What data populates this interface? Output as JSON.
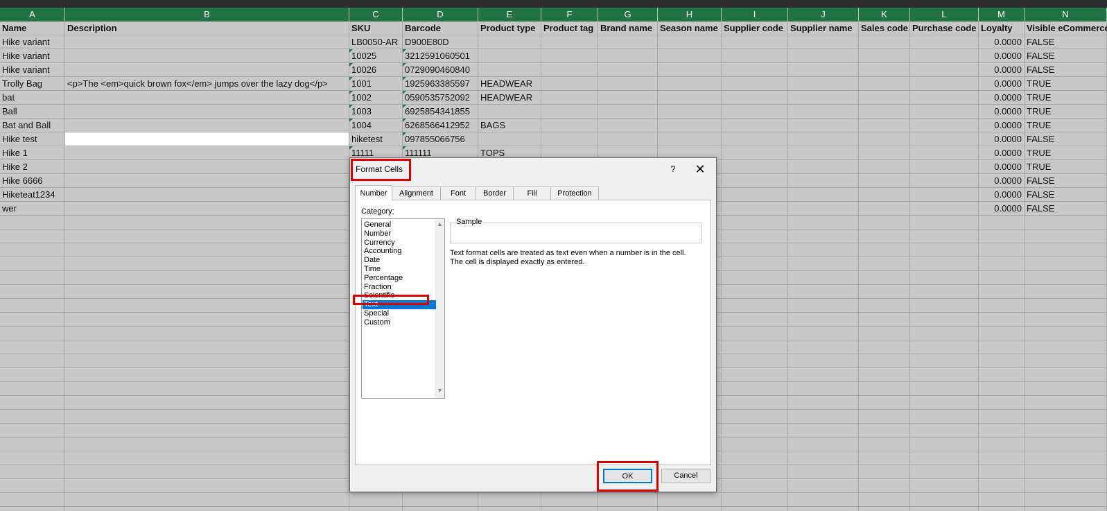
{
  "columns": [
    {
      "letter": "A",
      "header": "Name"
    },
    {
      "letter": "B",
      "header": "Description"
    },
    {
      "letter": "C",
      "header": "SKU"
    },
    {
      "letter": "D",
      "header": "Barcode"
    },
    {
      "letter": "E",
      "header": "Product type"
    },
    {
      "letter": "F",
      "header": "Product tag"
    },
    {
      "letter": "G",
      "header": "Brand name"
    },
    {
      "letter": "H",
      "header": "Season name"
    },
    {
      "letter": "I",
      "header": "Supplier code"
    },
    {
      "letter": "J",
      "header": "Supplier name"
    },
    {
      "letter": "K",
      "header": "Sales code"
    },
    {
      "letter": "L",
      "header": "Purchase code"
    },
    {
      "letter": "M",
      "header": "Loyalty"
    },
    {
      "letter": "N",
      "header": "Visible eCommerce"
    }
  ],
  "rows": [
    {
      "name": "Hike variant",
      "description": "",
      "sku": "LB0050-AR",
      "barcode": "D900E80D",
      "product_type": "",
      "loyalty": "0.0000",
      "visible": "FALSE"
    },
    {
      "name": "Hike variant",
      "description": "",
      "sku": "10025",
      "barcode": "3212591060501",
      "product_type": "",
      "loyalty": "0.0000",
      "visible": "FALSE"
    },
    {
      "name": "Hike variant",
      "description": "",
      "sku": "10026",
      "barcode": "0729090460840",
      "product_type": "",
      "loyalty": "0.0000",
      "visible": "FALSE"
    },
    {
      "name": "Trolly Bag",
      "description": "<p>The <em>quick brown fox</em> jumps over the lazy dog</p>",
      "sku": "1001",
      "barcode": "1925963385597",
      "product_type": "HEADWEAR",
      "loyalty": "0.0000",
      "visible": "TRUE"
    },
    {
      "name": "bat",
      "description": "",
      "sku": "1002",
      "barcode": "0590535752092",
      "product_type": "HEADWEAR",
      "loyalty": "0.0000",
      "visible": "TRUE"
    },
    {
      "name": "Ball",
      "description": "",
      "sku": "1003",
      "barcode": "6925854341855",
      "product_type": "",
      "loyalty": "0.0000",
      "visible": "TRUE"
    },
    {
      "name": "Bat and Ball",
      "description": "",
      "sku": "1004",
      "barcode": "6268566412952",
      "product_type": "BAGS",
      "loyalty": "0.0000",
      "visible": "TRUE"
    },
    {
      "name": "Hike test",
      "description": "",
      "sku": "hiketest",
      "barcode": "097855066756",
      "product_type": "",
      "loyalty": "0.0000",
      "visible": "FALSE"
    },
    {
      "name": "Hike 1",
      "description": "",
      "sku": "11111",
      "barcode": "111111",
      "product_type": "TOPS",
      "loyalty": "0.0000",
      "visible": "TRUE"
    },
    {
      "name": "Hike 2",
      "description": "",
      "sku": "",
      "barcode": "",
      "product_type": "",
      "loyalty": "0.0000",
      "visible": "TRUE"
    },
    {
      "name": "Hike 6666",
      "description": "",
      "sku": "",
      "barcode": "",
      "product_type": "",
      "loyalty": "0.0000",
      "visible": "FALSE"
    },
    {
      "name": "Hiketeat1234",
      "description": "",
      "sku": "",
      "barcode": "",
      "product_type": "",
      "loyalty": "0.0000",
      "visible": "FALSE"
    },
    {
      "name": "wer",
      "description": "",
      "sku": "",
      "barcode": "",
      "product_type": "",
      "loyalty": "0.0000",
      "visible": "FALSE"
    }
  ],
  "dialog": {
    "title": "Format Cells",
    "help": "?",
    "close_icon": "close-icon",
    "tabs": [
      "Number",
      "Alignment",
      "Font",
      "Border",
      "Fill",
      "Protection"
    ],
    "active_tab": "Number",
    "category_label": "Category:",
    "categories": [
      "General",
      "Number",
      "Currency",
      "Accounting",
      "Date",
      "Time",
      "Percentage",
      "Fraction",
      "Scientific",
      "Text",
      "Special",
      "Custom"
    ],
    "selected_category": "Text",
    "sample_label": "Sample",
    "description_line1": "Text format cells are treated as text even when a number is in the cell.",
    "description_line2": "The cell is displayed exactly as entered.",
    "ok_label": "OK",
    "cancel_label": "Cancel"
  },
  "colors": {
    "header_green": "#217346",
    "highlight_red": "#e00000",
    "selection_blue": "#0078d7",
    "error_triangle": "#1f7a3d"
  }
}
